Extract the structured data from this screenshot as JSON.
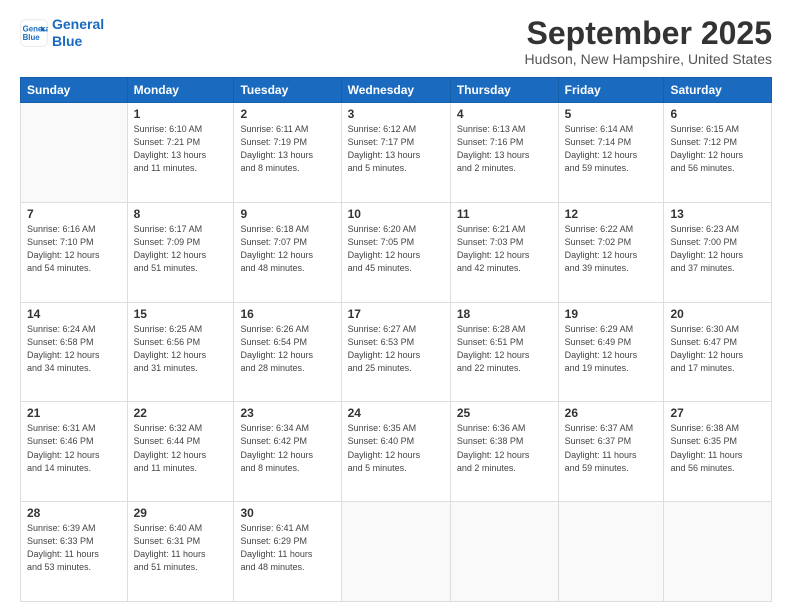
{
  "header": {
    "logo_line1": "General",
    "logo_line2": "Blue",
    "month": "September 2025",
    "location": "Hudson, New Hampshire, United States"
  },
  "weekdays": [
    "Sunday",
    "Monday",
    "Tuesday",
    "Wednesday",
    "Thursday",
    "Friday",
    "Saturday"
  ],
  "weeks": [
    [
      {
        "day": "",
        "info": ""
      },
      {
        "day": "1",
        "info": "Sunrise: 6:10 AM\nSunset: 7:21 PM\nDaylight: 13 hours\nand 11 minutes."
      },
      {
        "day": "2",
        "info": "Sunrise: 6:11 AM\nSunset: 7:19 PM\nDaylight: 13 hours\nand 8 minutes."
      },
      {
        "day": "3",
        "info": "Sunrise: 6:12 AM\nSunset: 7:17 PM\nDaylight: 13 hours\nand 5 minutes."
      },
      {
        "day": "4",
        "info": "Sunrise: 6:13 AM\nSunset: 7:16 PM\nDaylight: 13 hours\nand 2 minutes."
      },
      {
        "day": "5",
        "info": "Sunrise: 6:14 AM\nSunset: 7:14 PM\nDaylight: 12 hours\nand 59 minutes."
      },
      {
        "day": "6",
        "info": "Sunrise: 6:15 AM\nSunset: 7:12 PM\nDaylight: 12 hours\nand 56 minutes."
      }
    ],
    [
      {
        "day": "7",
        "info": "Sunrise: 6:16 AM\nSunset: 7:10 PM\nDaylight: 12 hours\nand 54 minutes."
      },
      {
        "day": "8",
        "info": "Sunrise: 6:17 AM\nSunset: 7:09 PM\nDaylight: 12 hours\nand 51 minutes."
      },
      {
        "day": "9",
        "info": "Sunrise: 6:18 AM\nSunset: 7:07 PM\nDaylight: 12 hours\nand 48 minutes."
      },
      {
        "day": "10",
        "info": "Sunrise: 6:20 AM\nSunset: 7:05 PM\nDaylight: 12 hours\nand 45 minutes."
      },
      {
        "day": "11",
        "info": "Sunrise: 6:21 AM\nSunset: 7:03 PM\nDaylight: 12 hours\nand 42 minutes."
      },
      {
        "day": "12",
        "info": "Sunrise: 6:22 AM\nSunset: 7:02 PM\nDaylight: 12 hours\nand 39 minutes."
      },
      {
        "day": "13",
        "info": "Sunrise: 6:23 AM\nSunset: 7:00 PM\nDaylight: 12 hours\nand 37 minutes."
      }
    ],
    [
      {
        "day": "14",
        "info": "Sunrise: 6:24 AM\nSunset: 6:58 PM\nDaylight: 12 hours\nand 34 minutes."
      },
      {
        "day": "15",
        "info": "Sunrise: 6:25 AM\nSunset: 6:56 PM\nDaylight: 12 hours\nand 31 minutes."
      },
      {
        "day": "16",
        "info": "Sunrise: 6:26 AM\nSunset: 6:54 PM\nDaylight: 12 hours\nand 28 minutes."
      },
      {
        "day": "17",
        "info": "Sunrise: 6:27 AM\nSunset: 6:53 PM\nDaylight: 12 hours\nand 25 minutes."
      },
      {
        "day": "18",
        "info": "Sunrise: 6:28 AM\nSunset: 6:51 PM\nDaylight: 12 hours\nand 22 minutes."
      },
      {
        "day": "19",
        "info": "Sunrise: 6:29 AM\nSunset: 6:49 PM\nDaylight: 12 hours\nand 19 minutes."
      },
      {
        "day": "20",
        "info": "Sunrise: 6:30 AM\nSunset: 6:47 PM\nDaylight: 12 hours\nand 17 minutes."
      }
    ],
    [
      {
        "day": "21",
        "info": "Sunrise: 6:31 AM\nSunset: 6:46 PM\nDaylight: 12 hours\nand 14 minutes."
      },
      {
        "day": "22",
        "info": "Sunrise: 6:32 AM\nSunset: 6:44 PM\nDaylight: 12 hours\nand 11 minutes."
      },
      {
        "day": "23",
        "info": "Sunrise: 6:34 AM\nSunset: 6:42 PM\nDaylight: 12 hours\nand 8 minutes."
      },
      {
        "day": "24",
        "info": "Sunrise: 6:35 AM\nSunset: 6:40 PM\nDaylight: 12 hours\nand 5 minutes."
      },
      {
        "day": "25",
        "info": "Sunrise: 6:36 AM\nSunset: 6:38 PM\nDaylight: 12 hours\nand 2 minutes."
      },
      {
        "day": "26",
        "info": "Sunrise: 6:37 AM\nSunset: 6:37 PM\nDaylight: 11 hours\nand 59 minutes."
      },
      {
        "day": "27",
        "info": "Sunrise: 6:38 AM\nSunset: 6:35 PM\nDaylight: 11 hours\nand 56 minutes."
      }
    ],
    [
      {
        "day": "28",
        "info": "Sunrise: 6:39 AM\nSunset: 6:33 PM\nDaylight: 11 hours\nand 53 minutes."
      },
      {
        "day": "29",
        "info": "Sunrise: 6:40 AM\nSunset: 6:31 PM\nDaylight: 11 hours\nand 51 minutes."
      },
      {
        "day": "30",
        "info": "Sunrise: 6:41 AM\nSunset: 6:29 PM\nDaylight: 11 hours\nand 48 minutes."
      },
      {
        "day": "",
        "info": ""
      },
      {
        "day": "",
        "info": ""
      },
      {
        "day": "",
        "info": ""
      },
      {
        "day": "",
        "info": ""
      }
    ]
  ]
}
